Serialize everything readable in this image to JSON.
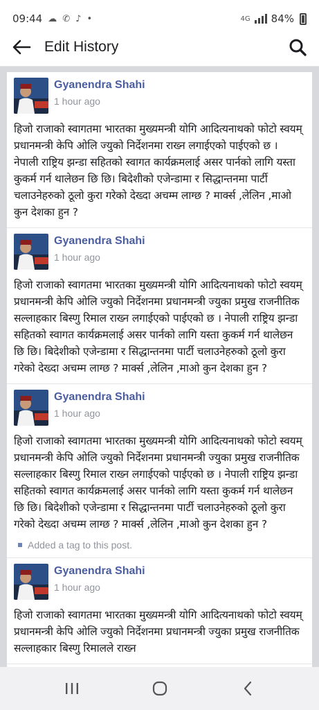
{
  "status": {
    "time": "09:44",
    "network": "4G",
    "battery": "84%"
  },
  "header": {
    "title": "Edit History"
  },
  "posts": [
    {
      "author": "Gyanendra Shahi",
      "time": "1 hour ago",
      "text": "हिजो राजाको स्वागतमा भारतका मुख्यमन्त्री योगि आदित्यनाथको फोटो स्वयम् प्रधानमन्त्री केपि ओलि ज्युको निर्देशनमा राख्न लगाईएको पाईएको छ । नेपाली राष्ट्रिय झन्डा सहितको स्वागत कार्यक्रमलाई असर पार्नको लागि यस्ता कुकर्म गर्न थालेछन छि छि। बिदेशीको एजेन्डामा र सिद्धान्तनमा पार्टी चलाउनेहरुको ठूलो कुरा गरेको देख्दा अचम्म लाग्छ ? मार्क्स ,लेलिन ,माओ कुन देशका हुन ?"
    },
    {
      "author": "Gyanendra Shahi",
      "time": "1 hour ago",
      "text": "हिजो राजाको स्वागतमा भारतका मुख्यमन्त्री योगि आदित्यनाथको फोटो स्वयम् प्रधानमन्त्री केपि ओलि ज्युको निर्देशनमा प्रधानमन्त्री ज्युका प्रमुख राजनीतिक सल्लाहकार बिस्णु रिमाल राख्न लगाईएको पाईएको छ । नेपाली राष्ट्रिय झन्डा सहितको स्वागत कार्यक्रमलाई असर पार्नको लागि यस्ता कुकर्म गर्न थालेछन छि छि। बिदेशीको एजेन्डामा र सिद्धान्तनमा पार्टी चलाउनेहरुको ठूलो कुरा गरेको देख्दा अचम्म लाग्छ ? मार्क्स ,लेलिन ,माओ कुन देशका हुन ?"
    },
    {
      "author": "Gyanendra Shahi",
      "time": "1 hour ago",
      "text": "हिजो राजाको स्वागतमा भारतका मुख्यमन्त्री योगि आदित्यनाथको फोटो स्वयम् प्रधानमन्त्री केपि ओलि ज्युको निर्देशनमा प्रधानमन्त्री ज्युका प्रमुख राजनीतिक सल्लाहकार बिस्णु रिमाल राख्न लगाईएको पाईएको छ । नेपाली राष्ट्रिय झन्डा सहितको स्वागत कार्यक्रमलाई असर पार्नको लागि यस्ता कुकर्म गर्न थालेछन छि छि। बिदेशीको एजेन्डामा र सिद्धान्तनमा पार्टी चलाउनेहरुको ठूलो कुरा गरेको देख्दा अचम्म लाग्छ ? मार्क्स ,लेलिन ,माओ कुन देशका हुन ?",
      "note": "Added a tag to this post."
    },
    {
      "author": "Gyanendra Shahi",
      "time": "1 hour ago",
      "text": "हिजो राजाको स्वागतमा भारतका मुख्यमन्त्री योगि आदित्यनाथको फोटो स्वयम् प्रधानमन्त्री केपि ओलि ज्युको निर्देशनमा प्रधानमन्त्री ज्युका प्रमुख राजनीतिक सल्लाहकार बिस्णु रिमालले राख्न"
    }
  ],
  "colors": {
    "author": "#4a5da0",
    "meta": "#90949c",
    "background": "#d7d9dd"
  },
  "icons": {
    "back": "arrow-left-icon",
    "search": "search-icon",
    "nav": [
      "recents-icon",
      "home-icon",
      "back-chevron-icon"
    ]
  }
}
